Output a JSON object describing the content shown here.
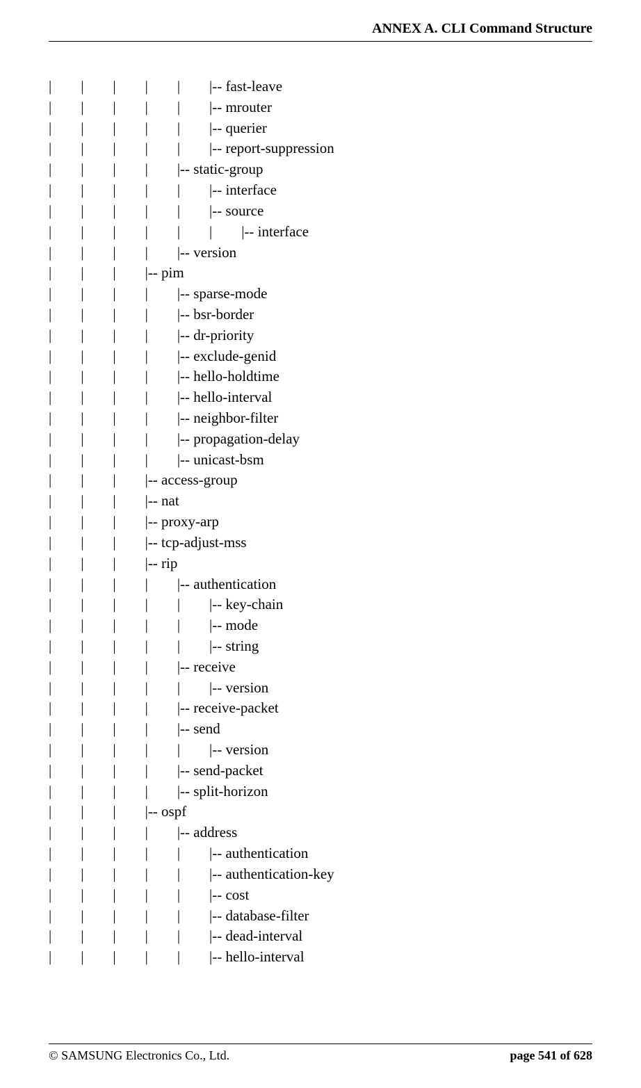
{
  "header": {
    "title": "ANNEX A. CLI Command Structure"
  },
  "tree": {
    "lines": [
      "|        |        |        |        |        |-- fast-leave",
      "|        |        |        |        |        |-- mrouter",
      "|        |        |        |        |        |-- querier",
      "|        |        |        |        |        |-- report-suppression",
      "|        |        |        |        |-- static-group",
      "|        |        |        |        |        |-- interface",
      "|        |        |        |        |        |-- source",
      "|        |        |        |        |        |        |-- interface",
      "|        |        |        |        |-- version",
      "|        |        |        |-- pim",
      "|        |        |        |        |-- sparse-mode",
      "|        |        |        |        |-- bsr-border",
      "|        |        |        |        |-- dr-priority",
      "|        |        |        |        |-- exclude-genid",
      "|        |        |        |        |-- hello-holdtime",
      "|        |        |        |        |-- hello-interval",
      "|        |        |        |        |-- neighbor-filter",
      "|        |        |        |        |-- propagation-delay",
      "|        |        |        |        |-- unicast-bsm",
      "|        |        |        |-- access-group",
      "|        |        |        |-- nat",
      "|        |        |        |-- proxy-arp",
      "|        |        |        |-- tcp-adjust-mss",
      "|        |        |        |-- rip",
      "|        |        |        |        |-- authentication",
      "|        |        |        |        |        |-- key-chain",
      "|        |        |        |        |        |-- mode",
      "|        |        |        |        |        |-- string",
      "|        |        |        |        |-- receive",
      "|        |        |        |        |        |-- version",
      "|        |        |        |        |-- receive-packet",
      "|        |        |        |        |-- send",
      "|        |        |        |        |        |-- version",
      "|        |        |        |        |-- send-packet",
      "|        |        |        |        |-- split-horizon",
      "|        |        |        |-- ospf",
      "|        |        |        |        |-- address",
      "|        |        |        |        |        |-- authentication",
      "|        |        |        |        |        |-- authentication-key",
      "|        |        |        |        |        |-- cost",
      "|        |        |        |        |        |-- database-filter",
      "|        |        |        |        |        |-- dead-interval",
      "|        |        |        |        |        |-- hello-interval"
    ]
  },
  "footer": {
    "left": "© SAMSUNG Electronics Co., Ltd.",
    "right": "page 541 of 628"
  }
}
